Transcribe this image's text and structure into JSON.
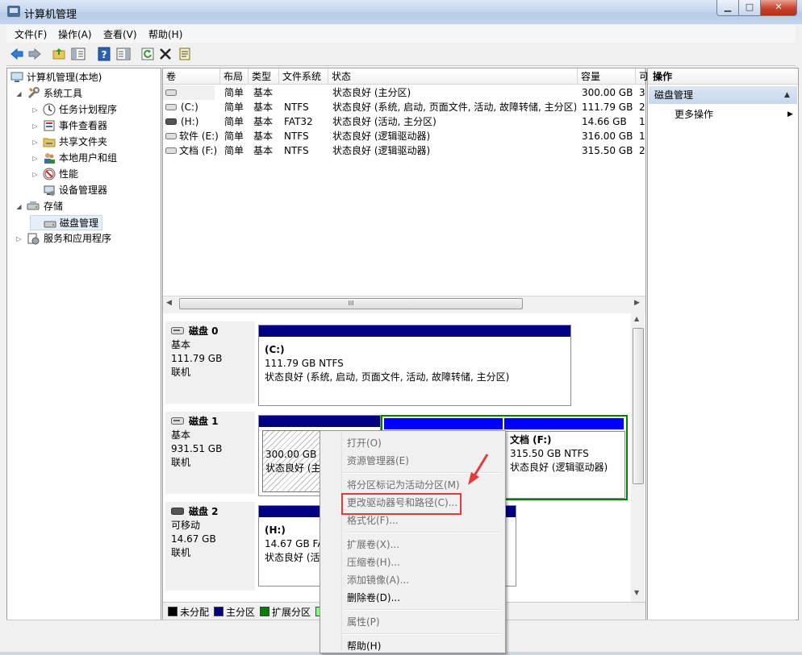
{
  "window": {
    "title": "计算机管理",
    "minimize_glyph": "▁",
    "maximize_glyph": "□",
    "close_glyph": "✕"
  },
  "menu": [
    "文件(F)",
    "操作(A)",
    "查看(V)",
    "帮助(H)"
  ],
  "toolbar": {
    "icons": [
      "back-arrow-icon",
      "forward-arrow-icon",
      "up-folder-icon",
      "show-hide-tree-icon",
      "help-icon",
      "show-hide-action-pane-icon",
      "refresh-icon",
      "delete-icon",
      "properties-icon"
    ]
  },
  "tree": {
    "root": "计算机管理(本地)",
    "system_tools": "系统工具",
    "task_scheduler": "任务计划程序",
    "event_viewer": "事件查看器",
    "shared_folders": "共享文件夹",
    "local_users": "本地用户和组",
    "performance": "性能",
    "device_manager": "设备管理器",
    "storage": "存储",
    "disk_management": "磁盘管理",
    "services": "服务和应用程序"
  },
  "volume_table": {
    "columns": [
      "卷",
      "布局",
      "类型",
      "文件系统",
      "状态",
      "容量",
      "可"
    ],
    "rows": [
      {
        "vol": "",
        "layout": "简单",
        "type": "基本",
        "fs": "",
        "status": "状态良好 (主分区)",
        "capacity": "300.00 GB",
        "free": "3"
      },
      {
        "vol": "(C:)",
        "layout": "简单",
        "type": "基本",
        "fs": "NTFS",
        "status": "状态良好 (系统, 启动, 页面文件, 活动, 故障转储, 主分区)",
        "capacity": "111.79 GB",
        "free": "2"
      },
      {
        "vol": "(H:)",
        "layout": "简单",
        "type": "基本",
        "fs": "FAT32",
        "status": "状态良好 (活动, 主分区)",
        "capacity": "14.66 GB",
        "free": "1"
      },
      {
        "vol": "软件 (E:)",
        "layout": "简单",
        "type": "基本",
        "fs": "NTFS",
        "status": "状态良好 (逻辑驱动器)",
        "capacity": "316.00 GB",
        "free": "1"
      },
      {
        "vol": "文档 (F:)",
        "layout": "简单",
        "type": "基本",
        "fs": "NTFS",
        "status": "状态良好 (逻辑驱动器)",
        "capacity": "315.50 GB",
        "free": "2"
      }
    ]
  },
  "hscroll_grip": "III",
  "disks": [
    {
      "name": "磁盘 0",
      "kind": "基本",
      "size": "111.79 GB",
      "state": "联机"
    },
    {
      "name": "磁盘 1",
      "kind": "基本",
      "size": "931.51 GB",
      "state": "联机"
    },
    {
      "name": "磁盘 2",
      "kind": "可移动",
      "size": "14.67 GB",
      "state": "联机"
    }
  ],
  "partitions": {
    "c": {
      "name": "(C:)",
      "size": "111.79 GB NTFS",
      "status": "状态良好 (系统, 启动, 页面文件, 活动, 故障转储, 主分区)"
    },
    "d1": {
      "size": "300.00 GB",
      "status": "状态良好 (主"
    },
    "f": {
      "name": "文档  (F:)",
      "size": "315.50 GB NTFS",
      "status": "状态良好 (逻辑驱动器)"
    },
    "h": {
      "name": "(H:)",
      "size": "14.67 GB FA",
      "status": "状态良好 (活"
    }
  },
  "legend": [
    "未分配",
    "主分区",
    "扩展分区"
  ],
  "legend_colors": [
    "#000000",
    "#000080",
    "#008000",
    "#80ff80"
  ],
  "actions": {
    "header": "操作",
    "section": "磁盘管理",
    "more": "更多操作"
  },
  "context_menu": {
    "open": "打开(O)",
    "explore": "资源管理器(E)",
    "mark_active": "将分区标记为活动分区(M)",
    "change_letter": "更改驱动器号和路径(C)...",
    "format": "格式化(F)...",
    "extend": "扩展卷(X)...",
    "shrink": "压缩卷(H)...",
    "mirror": "添加镜像(A)...",
    "delete": "删除卷(D)...",
    "properties": "属性(P)",
    "help": "帮助(H)"
  },
  "colors": {
    "primary": "#000080",
    "extended": "#008000",
    "highlight": "#e53a3a"
  }
}
